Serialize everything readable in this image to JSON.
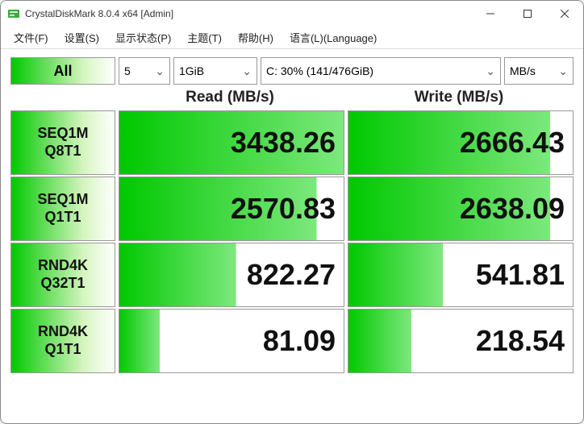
{
  "window": {
    "title": "CrystalDiskMark 8.0.4 x64 [Admin]"
  },
  "menu": {
    "file": "文件(F)",
    "settings": "设置(S)",
    "display": "显示状态(P)",
    "theme": "主题(T)",
    "help": "帮助(H)",
    "language": "语言(L)(Language)"
  },
  "controls": {
    "all_label": "All",
    "count": "5",
    "size": "1GiB",
    "drive": "C: 30% (141/476GiB)",
    "unit": "MB/s"
  },
  "headers": {
    "read": "Read (MB/s)",
    "write": "Write (MB/s)"
  },
  "tests": [
    {
      "label1": "SEQ1M",
      "label2": "Q8T1",
      "read": "3438.26",
      "read_pct": "100%",
      "write": "2666.43",
      "write_pct": "90%"
    },
    {
      "label1": "SEQ1M",
      "label2": "Q1T1",
      "read": "2570.83",
      "read_pct": "88%",
      "write": "2638.09",
      "write_pct": "90%"
    },
    {
      "label1": "RND4K",
      "label2": "Q32T1",
      "read": "822.27",
      "read_pct": "52%",
      "write": "541.81",
      "write_pct": "42%"
    },
    {
      "label1": "RND4K",
      "label2": "Q1T1",
      "read": "81.09",
      "read_pct": "18%",
      "write": "218.54",
      "write_pct": "28%"
    }
  ]
}
